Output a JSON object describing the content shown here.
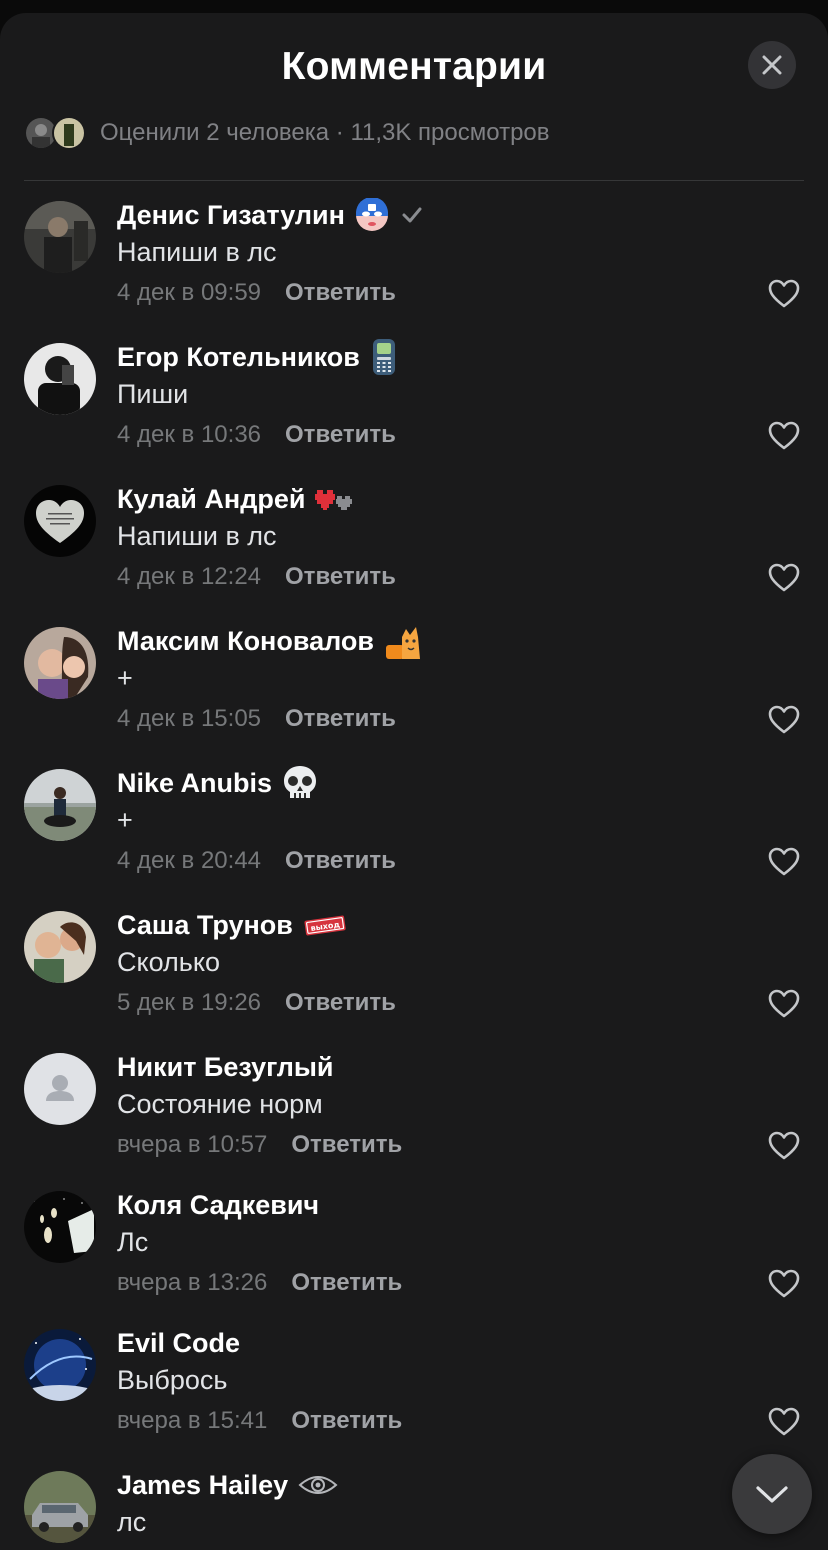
{
  "header": {
    "title": "Комментарии"
  },
  "stats": {
    "text": "Оценили 2 человека · 11,3K просмотров"
  },
  "comments": [
    {
      "name": "Денис Гизатулин",
      "text": "Напиши в лс",
      "time": "4 дек в 09:59",
      "reply": "Ответить",
      "emoji": "hero-mask-emoji",
      "verified": true
    },
    {
      "name": "Егор Котельников",
      "text": "Пиши",
      "time": "4 дек в 10:36",
      "reply": "Ответить",
      "emoji": "phone-emoji"
    },
    {
      "name": "Кулай Андрей",
      "text": "Напиши в лс",
      "time": "4 дек в 12:24",
      "reply": "Ответить",
      "emoji": "pixel-hearts-emoji"
    },
    {
      "name": "Максим Коновалов",
      "text": "+",
      "time": "4 дек в 15:05",
      "reply": "Ответить",
      "emoji": "cat-emoji"
    },
    {
      "name": "Nike Anubis",
      "text": "+",
      "time": "4 дек в 20:44",
      "reply": "Ответить",
      "emoji": "skull-emoji"
    },
    {
      "name": "Саша Трунов",
      "text": "Сколько",
      "time": "5 дек в 19:26",
      "reply": "Ответить",
      "emoji": "exit-sign-emoji",
      "emoji_text": "выход"
    },
    {
      "name": "Никит Безуглый",
      "text": "Состояние норм",
      "time": "вчера в 10:57",
      "reply": "Ответить"
    },
    {
      "name": "Коля Садкевич",
      "text": "Лс",
      "time": "вчера в 13:26",
      "reply": "Ответить"
    },
    {
      "name": "Evil Code",
      "text": "Выбрось",
      "time": "вчера в 15:41",
      "reply": "Ответить"
    },
    {
      "name": "James Hailey",
      "text": "лс",
      "emoji": "eye-emoji"
    }
  ],
  "icons": {
    "close": "close-icon",
    "like": "heart-outline-icon",
    "scroll_down": "chevron-down-icon",
    "verified": "checkmark-icon"
  },
  "colors": {
    "background": "#1a1a1b",
    "text_primary": "#ffffff",
    "text_secondary": "#76787a",
    "reply": "#a0a2a6"
  }
}
